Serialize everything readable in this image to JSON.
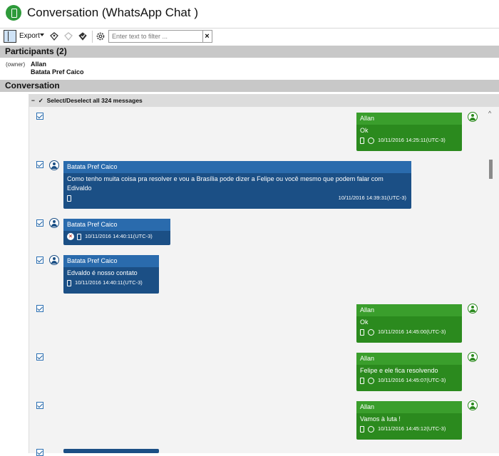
{
  "window": {
    "title": "Conversation (WhatsApp Chat )"
  },
  "toolbar": {
    "export_label": "Export",
    "filter_placeholder": "Enter text to filter ...",
    "clear_label": "×"
  },
  "participants": {
    "header": "Participants (2)",
    "owner_role": "(owner)",
    "owner_name": "Allan",
    "other_name": "Batata Pref Caico"
  },
  "conversation": {
    "header": "Conversation",
    "select_all": "Select/Deselect all 324 messages",
    "messages": [
      {
        "sender": "Allan",
        "text": "Ok",
        "time": "10/11/2016 14:25:11(UTC-3)",
        "side": "right"
      },
      {
        "sender": "Batata Pref Caico",
        "text": "Como tenho muita coisa pra resolver e vou a Brasília pode dizer a Felipe ou você mesmo que podem falar com Edivaldo",
        "time": "10/11/2016 14:39:31(UTC-3)",
        "side": "left"
      },
      {
        "sender": "Batata Pref Caico",
        "text": "",
        "time": "10/11/2016 14:40:11(UTC-3)",
        "side": "left",
        "deleted": true
      },
      {
        "sender": "Batata Pref Caico",
        "text": "Edvaldo é nosso contato",
        "time": "10/11/2016 14:40:11(UTC-3)",
        "side": "left"
      },
      {
        "sender": "Allan",
        "text": "Ok",
        "time": "10/11/2016 14:45:00(UTC-3)",
        "side": "right"
      },
      {
        "sender": "Allan",
        "text": "Felipe e ele fica resolvendo",
        "time": "10/11/2016 14:45:07(UTC-3)",
        "side": "right"
      },
      {
        "sender": "Allan",
        "text": "Vamos à luta !",
        "time": "10/11/2016 14:45:12(UTC-3)",
        "side": "right"
      }
    ]
  },
  "colors": {
    "outgoing": "#2b8a1e",
    "incoming": "#1b4f85",
    "section_header": "#c8c8c8"
  },
  "icons": [
    "whatsapp-app-icon",
    "pane-toggle-icon",
    "tag-icon",
    "untag-icon",
    "tag-check-icon",
    "gear-icon",
    "clear-icon",
    "phone-icon",
    "contacts-icon",
    "delete-icon",
    "avatar-icon",
    "scroll-up-icon"
  ]
}
